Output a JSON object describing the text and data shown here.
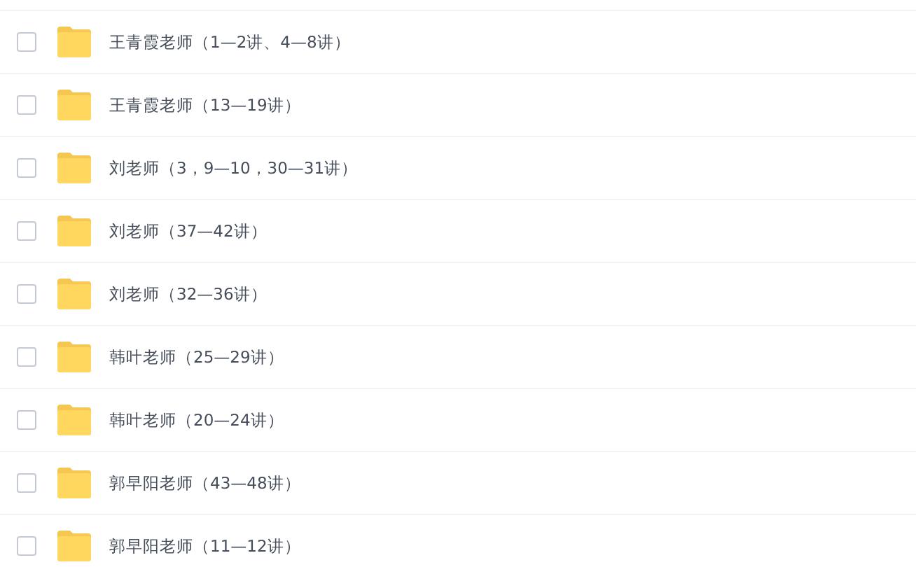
{
  "files": [
    {
      "name": "王青霞老师（1—2讲、4—8讲）",
      "checked": false
    },
    {
      "name": "王青霞老师（13—19讲）",
      "checked": false
    },
    {
      "name": "刘老师（3，9—10，30—31讲）",
      "checked": false
    },
    {
      "name": "刘老师（37—42讲）",
      "checked": false
    },
    {
      "name": "刘老师（32—36讲）",
      "checked": false
    },
    {
      "name": "韩叶老师（25—29讲）",
      "checked": false
    },
    {
      "name": "韩叶老师（20—24讲）",
      "checked": false
    },
    {
      "name": "郭早阳老师（43—48讲）",
      "checked": false
    },
    {
      "name": "郭早阳老师（11—12讲）",
      "checked": false
    }
  ]
}
